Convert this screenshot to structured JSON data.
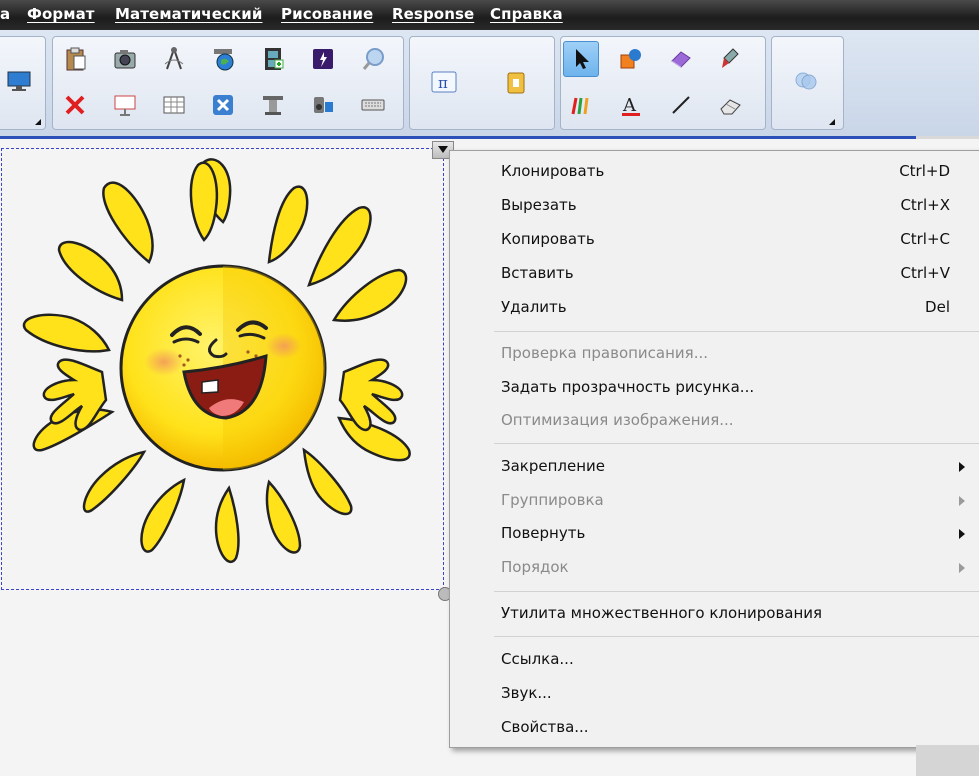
{
  "menubar": {
    "items": [
      {
        "label": "а"
      },
      {
        "label": "Формат"
      },
      {
        "label": "Математический"
      },
      {
        "label": "Рисование"
      },
      {
        "label": "Response"
      },
      {
        "label": "Справка"
      }
    ]
  },
  "toolbar": {
    "icons": [
      "monitor-icon",
      "paste-icon",
      "camera-icon",
      "compass-icon",
      "globe-icon",
      "filmstrip-icon",
      "flash-icon",
      "magnifier-icon",
      "delete-icon",
      "screen-icon",
      "table-icon",
      "close-box-icon",
      "podium-icon",
      "speaker-icon",
      "keyboard-icon",
      "pi-icon",
      "lock-icon",
      "pointer-icon",
      "shapes-icon",
      "eraser-icon",
      "pen-icon",
      "pencils-icon",
      "text-icon",
      "line-icon",
      "eraser2-icon",
      "circles-icon"
    ],
    "colors": {
      "accent": "#2d4fb8",
      "selection": "#3b44c8",
      "sun": "#ffe21a"
    }
  },
  "context_menu": {
    "items": [
      {
        "label": "Клонировать",
        "shortcut": "Ctrl+D",
        "enabled": true
      },
      {
        "label": "Вырезать",
        "shortcut": "Ctrl+X",
        "enabled": true
      },
      {
        "label": "Копировать",
        "shortcut": "Ctrl+C",
        "enabled": true
      },
      {
        "label": "Вставить",
        "shortcut": "Ctrl+V",
        "enabled": true
      },
      {
        "label": "Удалить",
        "shortcut": "Del",
        "enabled": true
      },
      {
        "label": "Проверка правописания...",
        "enabled": false
      },
      {
        "label": "Задать прозрачность рисунка...",
        "enabled": true
      },
      {
        "label": "Оптимизация изображения...",
        "enabled": false
      },
      {
        "label": "Закрепление",
        "submenu": true,
        "enabled": true
      },
      {
        "label": "Группировка",
        "submenu": true,
        "enabled": false
      },
      {
        "label": "Повернуть",
        "submenu": true,
        "enabled": true
      },
      {
        "label": "Порядок",
        "submenu": true,
        "enabled": false
      },
      {
        "label": "Утилита множественного клонирования",
        "enabled": true
      },
      {
        "label": "Ссылка...",
        "enabled": true
      },
      {
        "label": "Звук...",
        "enabled": true
      },
      {
        "label": "Свойства...",
        "enabled": true
      }
    ]
  }
}
